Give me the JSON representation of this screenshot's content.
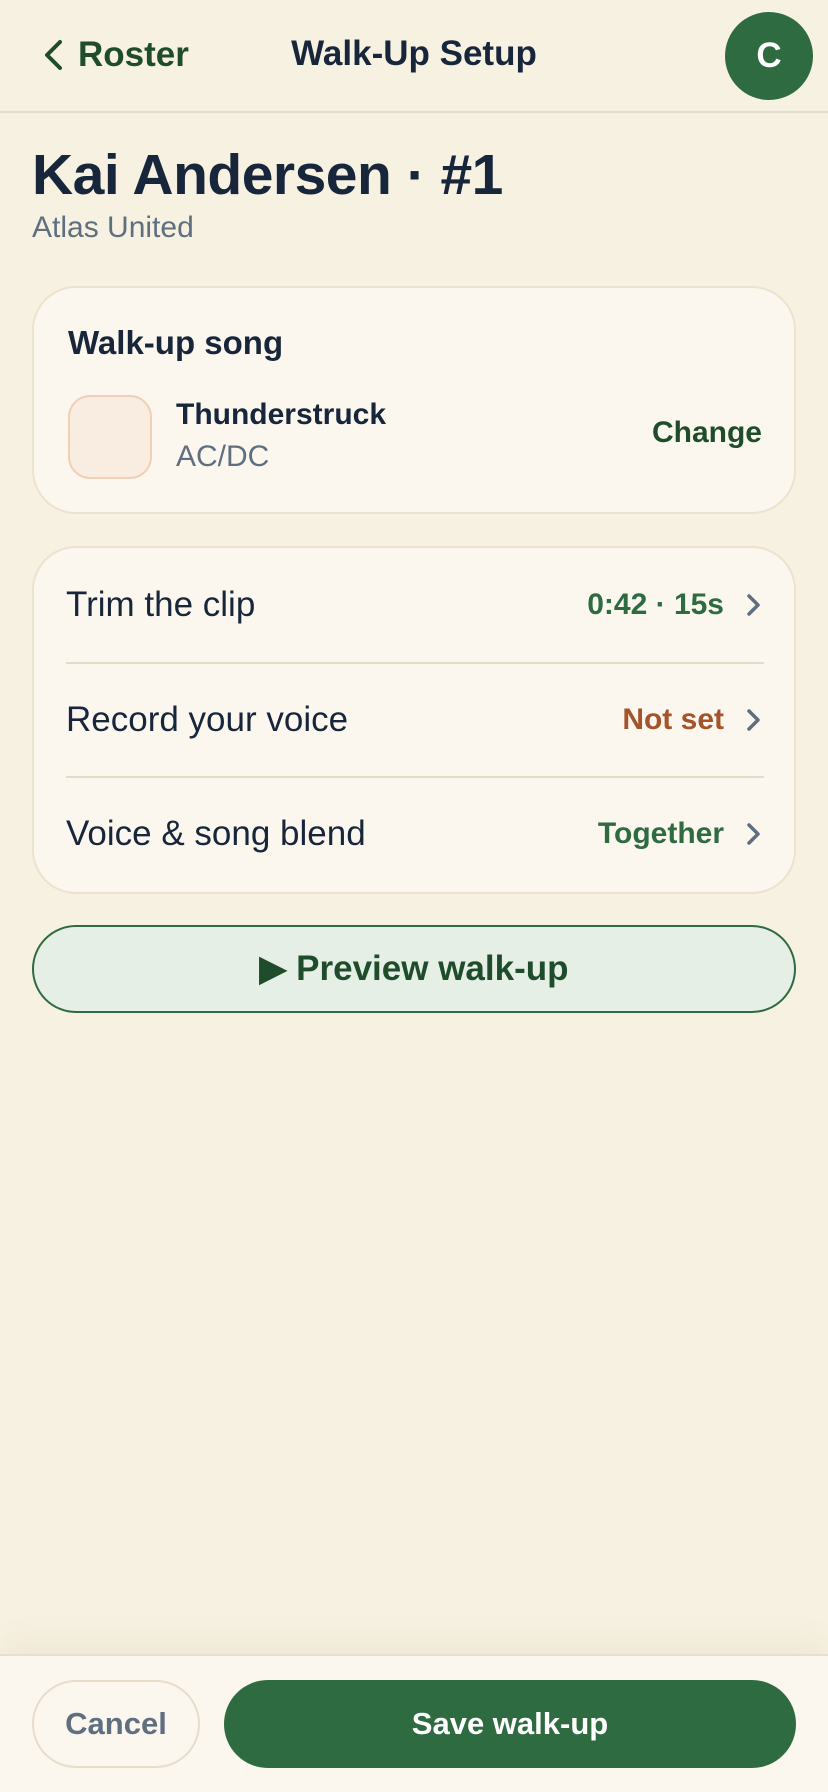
{
  "header": {
    "back_label": "Roster",
    "title": "Walk-Up Setup",
    "avatar_initial": "C"
  },
  "player": {
    "name": "Kai Andersen · #1",
    "team": "Atlas United"
  },
  "song_card": {
    "title": "Walk-up song",
    "song_title": "Thunderstruck",
    "artist": "AC/DC",
    "change_label": "Change"
  },
  "settings": {
    "rows": [
      {
        "label": "Trim the clip",
        "value": "0:42 · 15s",
        "value_color": "#2e6b40"
      },
      {
        "label": "Record your voice",
        "value": "Not set",
        "value_color": "#a4532a"
      },
      {
        "label": "Voice & song blend",
        "value": "Together",
        "value_color": "#2e6b40"
      }
    ]
  },
  "preview": {
    "label": "▶ Preview walk-up"
  },
  "footer": {
    "cancel_label": "Cancel",
    "save_label": "Save walk-up"
  },
  "icons": {
    "back": "chevron-left-icon",
    "row_chevron": "chevron-right-icon"
  },
  "colors": {
    "accent": "#2e6b40",
    "background": "#f7f1e1",
    "warning": "#a4532a"
  }
}
